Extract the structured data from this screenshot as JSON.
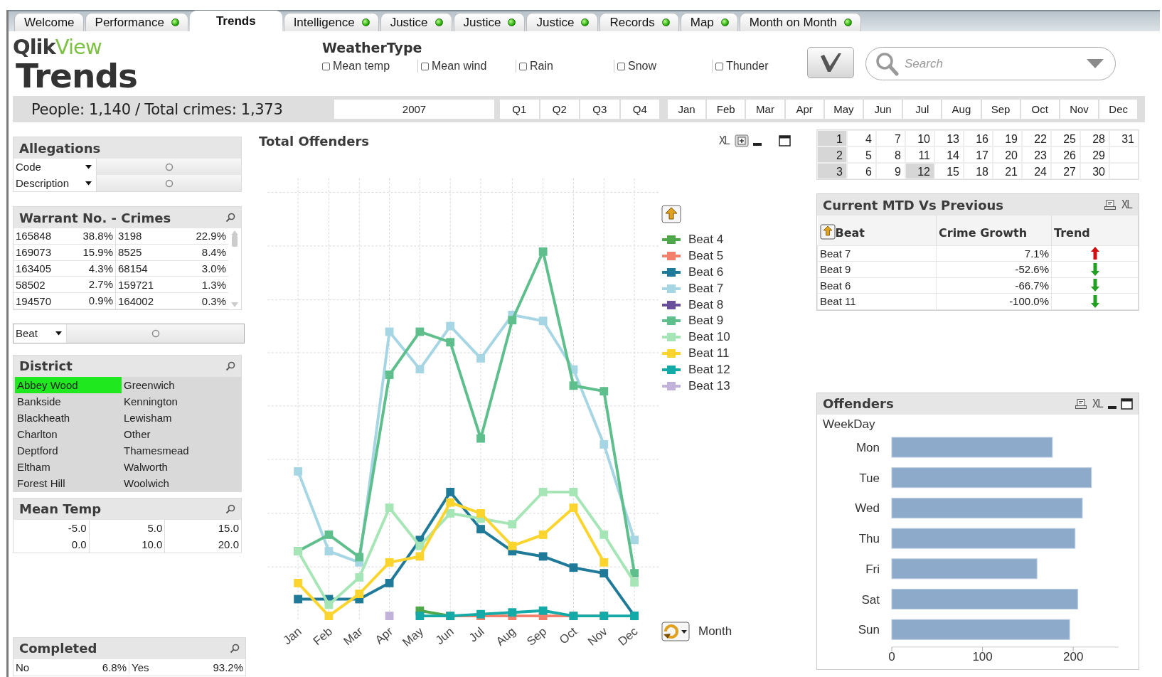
{
  "tabs": [
    {
      "label": "Welcome",
      "selected": false,
      "status_dot": false
    },
    {
      "label": "Performance",
      "selected": false,
      "status_dot": true
    },
    {
      "label": "Trends",
      "selected": true,
      "status_dot": false
    },
    {
      "label": "Intelligence",
      "selected": false,
      "status_dot": true
    },
    {
      "label": "Justice",
      "selected": false,
      "status_dot": true
    },
    {
      "label": "Justice",
      "selected": false,
      "status_dot": true
    },
    {
      "label": "Justice",
      "selected": false,
      "status_dot": true
    },
    {
      "label": "Records",
      "selected": false,
      "status_dot": true
    },
    {
      "label": "Map",
      "selected": false,
      "status_dot": true
    },
    {
      "label": "Month on Month",
      "selected": false,
      "status_dot": true
    }
  ],
  "header": {
    "logo": {
      "text": "Qlik",
      "accent": "View"
    },
    "title": "Trends"
  },
  "weather_type": {
    "title": "WeatherType",
    "options": [
      {
        "label": "Mean temp",
        "checked": false
      },
      {
        "label": "Mean wind",
        "checked": false
      },
      {
        "label": "Rain",
        "checked": false
      },
      {
        "label": "Snow",
        "checked": false
      },
      {
        "label": "Thunder",
        "checked": false
      }
    ]
  },
  "search": {
    "placeholder": "Search"
  },
  "summary": "People: 1,140 / Total crimes: 1,373",
  "period": {
    "years": [
      {
        "label": "2007",
        "selected": false
      }
    ],
    "quarters": [
      {
        "label": "Q1",
        "selected": false
      },
      {
        "label": "Q2",
        "selected": false
      },
      {
        "label": "Q3",
        "selected": false
      },
      {
        "label": "Q4",
        "selected": false
      }
    ],
    "months": [
      {
        "label": "Jan",
        "selected": false
      },
      {
        "label": "Feb",
        "selected": false
      },
      {
        "label": "Mar",
        "selected": false
      },
      {
        "label": "Apr",
        "selected": false
      },
      {
        "label": "May",
        "selected": false
      },
      {
        "label": "Jun",
        "selected": false
      },
      {
        "label": "Jul",
        "selected": false
      },
      {
        "label": "Aug",
        "selected": false
      },
      {
        "label": "Sep",
        "selected": false
      },
      {
        "label": "Oct",
        "selected": false
      },
      {
        "label": "Nov",
        "selected": false
      },
      {
        "label": "Dec",
        "selected": false
      }
    ]
  },
  "calendar_days": [
    {
      "label": "1",
      "excluded": true
    },
    {
      "label": "2",
      "excluded": true
    },
    {
      "label": "3",
      "excluded": true
    },
    {
      "label": "4",
      "excluded": false
    },
    {
      "label": "5",
      "excluded": false
    },
    {
      "label": "6",
      "excluded": false
    },
    {
      "label": "7",
      "excluded": false
    },
    {
      "label": "8",
      "excluded": false
    },
    {
      "label": "9",
      "excluded": false
    },
    {
      "label": "10",
      "excluded": false
    },
    {
      "label": "11",
      "excluded": false
    },
    {
      "label": "12",
      "excluded": true
    },
    {
      "label": "13",
      "excluded": false
    },
    {
      "label": "14",
      "excluded": false
    },
    {
      "label": "15",
      "excluded": false
    },
    {
      "label": "16",
      "excluded": false
    },
    {
      "label": "17",
      "excluded": false
    },
    {
      "label": "18",
      "excluded": false
    },
    {
      "label": "19",
      "excluded": false
    },
    {
      "label": "20",
      "excluded": false
    },
    {
      "label": "21",
      "excluded": false
    },
    {
      "label": "22",
      "excluded": false
    },
    {
      "label": "23",
      "excluded": false
    },
    {
      "label": "24",
      "excluded": false
    },
    {
      "label": "25",
      "excluded": false
    },
    {
      "label": "26",
      "excluded": false
    },
    {
      "label": "27",
      "excluded": false
    },
    {
      "label": "28",
      "excluded": false
    },
    {
      "label": "29",
      "excluded": false
    },
    {
      "label": "30",
      "excluded": false
    },
    {
      "label": "31",
      "excluded": false
    }
  ],
  "allegations": {
    "title": "Allegations",
    "fields": [
      {
        "label": "Code"
      },
      {
        "label": "Description"
      }
    ]
  },
  "warrant_crimes": {
    "title": "Warrant No. - Crimes",
    "rows": [
      {
        "warrant": "165848",
        "warrant_share": "38.8%",
        "crimes": "3198",
        "crimes_share": "22.9%"
      },
      {
        "warrant": "169073",
        "warrant_share": "15.9%",
        "crimes": "8525",
        "crimes_share": "8.4%"
      },
      {
        "warrant": "163405",
        "warrant_share": "4.3%",
        "crimes": "68154",
        "crimes_share": "3.0%"
      },
      {
        "warrant": "58502",
        "warrant_share": "2.7%",
        "crimes": "159721",
        "crimes_share": "1.3%"
      },
      {
        "warrant": "194570",
        "warrant_share": "0.9%",
        "crimes": "164002",
        "crimes_share": "0.3%"
      }
    ]
  },
  "beat_field": {
    "label": "Beat"
  },
  "district": {
    "title": "District",
    "items": [
      {
        "label": "Abbey Wood",
        "selected": true
      },
      {
        "label": "Bankside",
        "selected": false
      },
      {
        "label": "Blackheath",
        "selected": false
      },
      {
        "label": "Charlton",
        "selected": false
      },
      {
        "label": "Deptford",
        "selected": false
      },
      {
        "label": "Eltham",
        "selected": false
      },
      {
        "label": "Forest Hill",
        "selected": false
      },
      {
        "label": "Greenwich",
        "selected": false
      },
      {
        "label": "Kennington",
        "selected": false
      },
      {
        "label": "Lewisham",
        "selected": false
      },
      {
        "label": "Other",
        "selected": false
      },
      {
        "label": "Thamesmead",
        "selected": false
      },
      {
        "label": "Walworth",
        "selected": false
      },
      {
        "label": "Woolwich",
        "selected": false
      }
    ]
  },
  "mean_temp": {
    "title": "Mean Temp",
    "values": [
      "-5.0",
      "0.0",
      "5.0",
      "10.0",
      "15.0",
      "20.0"
    ]
  },
  "completed": {
    "title": "Completed",
    "items": [
      {
        "label": "No",
        "share": "6.8%"
      },
      {
        "label": "Yes",
        "share": "93.2%"
      }
    ]
  },
  "total_offenders": {
    "title": "Total Offenders",
    "export_label": "XL",
    "x_labels": [
      "Jan",
      "Feb",
      "Mar",
      "Apr",
      "May",
      "Jun",
      "Jul",
      "Aug",
      "Sep",
      "Oct",
      "Nov",
      "Dec"
    ],
    "legend": [
      {
        "name": "Beat 4",
        "color": "#4ea84a"
      },
      {
        "name": "Beat 5",
        "color": "#f4806c"
      },
      {
        "name": "Beat 6",
        "color": "#1f7a99"
      },
      {
        "name": "Beat 7",
        "color": "#a6d6e4"
      },
      {
        "name": "Beat 8",
        "color": "#6a509c"
      },
      {
        "name": "Beat 9",
        "color": "#5ebf8c"
      },
      {
        "name": "Beat 10",
        "color": "#a6e6b6"
      },
      {
        "name": "Beat 11",
        "color": "#fbd52e"
      },
      {
        "name": "Beat 12",
        "color": "#14aaa8"
      },
      {
        "name": "Beat 13",
        "color": "#c2b2da"
      }
    ],
    "dimension": "Month"
  },
  "mtd_table": {
    "title": "Current MTD Vs Previous",
    "export_label": "XL",
    "columns": [
      "Beat",
      "Crime Growth",
      "Trend"
    ],
    "rows": [
      {
        "beat": "Beat 7",
        "growth": "7.1%",
        "trend_up": true
      },
      {
        "beat": "Beat 9",
        "growth": "-52.6%",
        "trend_up": false
      },
      {
        "beat": "Beat 6",
        "growth": "-66.7%",
        "trend_up": false
      },
      {
        "beat": "Beat 11",
        "growth": "-100.0%",
        "trend_up": false
      }
    ]
  },
  "offenders": {
    "title": "Offenders",
    "export_label": "XL",
    "chart_data": {
      "type": "bar",
      "orientation": "horizontal",
      "ylabel": "WeekDay",
      "categories": [
        "Mon",
        "Tue",
        "Wed",
        "Thu",
        "Fri",
        "Sat",
        "Sun"
      ],
      "values": [
        177,
        220,
        210,
        202,
        160,
        205,
        196
      ],
      "xticks": [
        0,
        100,
        200
      ],
      "xlim": [
        0,
        250
      ]
    }
  }
}
